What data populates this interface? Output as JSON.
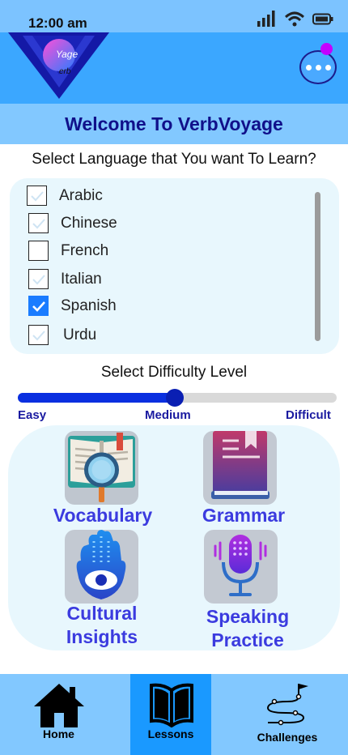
{
  "status_bar": {
    "time": "12:00 am",
    "icons": [
      "signal-icon",
      "wifi-icon",
      "battery-icon"
    ]
  },
  "header": {
    "logo_top": "Yage",
    "logo_bottom": "erb",
    "menu_icon": "more-dots-icon"
  },
  "welcome": {
    "title": "Welcome To VerbVoyage"
  },
  "language": {
    "prompt": "Select Language that You want To Learn?",
    "options": [
      {
        "label": "Arabic",
        "checked": false
      },
      {
        "label": "Chinese",
        "checked": false
      },
      {
        "label": "French",
        "checked": false
      },
      {
        "label": "Italian",
        "checked": false
      },
      {
        "label": "Spanish",
        "checked": true
      },
      {
        "label": "Urdu",
        "checked": false
      }
    ]
  },
  "difficulty": {
    "title": "Select Difficulty Level",
    "labels": [
      "Easy",
      "Medium",
      "Difficult"
    ],
    "selected": "Medium",
    "value_fraction": 0.5
  },
  "features": [
    {
      "label": "Vocabulary",
      "icon": "book-magnifier-icon"
    },
    {
      "label": "Grammar",
      "icon": "grammar-book-icon"
    },
    {
      "label": "Cultural Insights",
      "icon": "hamsa-hand-icon"
    },
    {
      "label": "Speaking Practice",
      "icon": "microphone-icon"
    }
  ],
  "bottom_nav": {
    "items": [
      {
        "label": "Home",
        "icon": "home-icon",
        "active": false
      },
      {
        "label": "Lessons",
        "icon": "book-icon",
        "active": true
      },
      {
        "label": "Challenges",
        "icon": "path-flag-icon",
        "active": false
      }
    ]
  },
  "colors": {
    "header_bg": "#3ba7ff",
    "welcome_bg": "#82c8ff",
    "title_text": "#10108a",
    "feature_text": "#3b3bdf",
    "slider_fill": "#0a2fe0",
    "checkbox_checked": "#1a7cff",
    "nav_active": "#1a99ff"
  }
}
